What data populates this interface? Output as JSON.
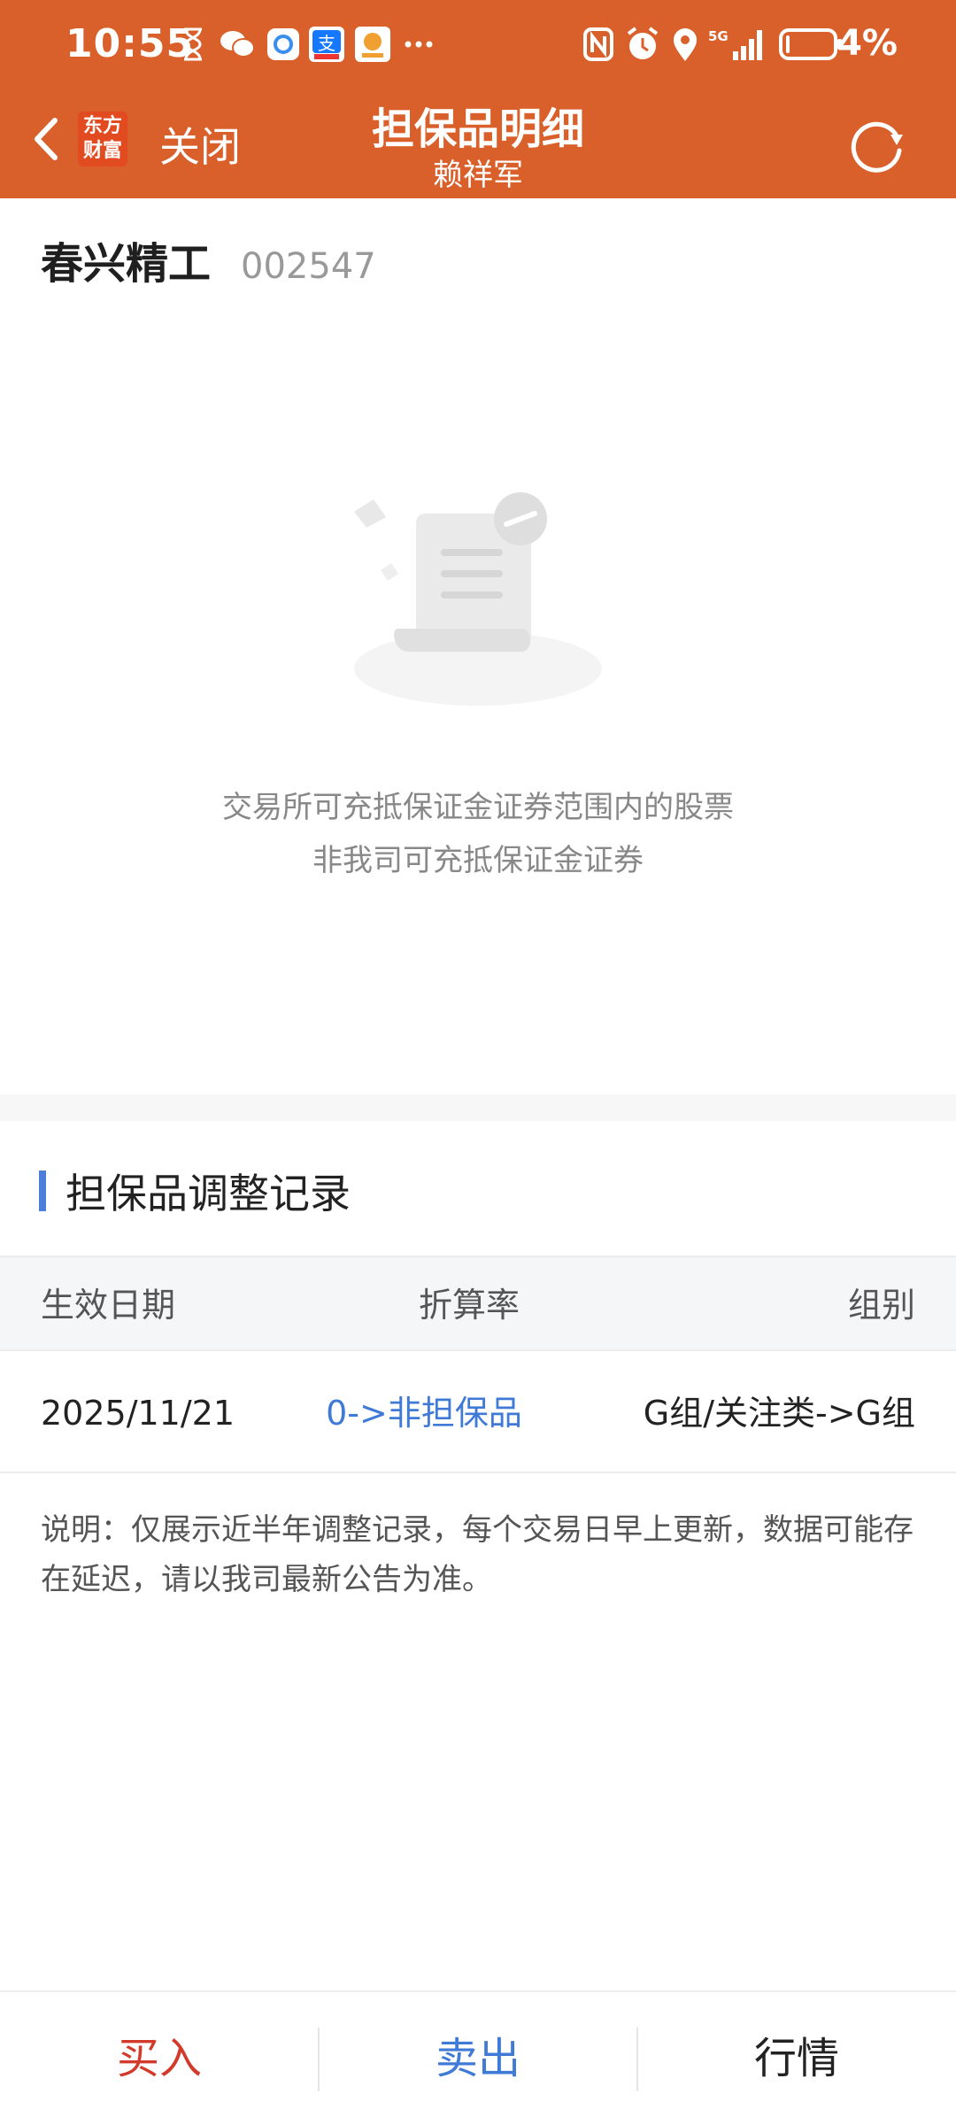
{
  "status_bar": {
    "time": "10:55",
    "network": "5G",
    "battery": "4%"
  },
  "header": {
    "logo_text": "东方财富",
    "close_label": "关闭",
    "title": "担保品明细",
    "subtitle": "赖祥军"
  },
  "stock": {
    "name": "春兴精工",
    "code": "002547"
  },
  "empty_state": {
    "line1": "交易所可充抵保证金证券范围内的股票",
    "line2": "非我司可充抵保证金证券"
  },
  "records": {
    "section_title": "担保品调整记录",
    "columns": [
      "生效日期",
      "折算率",
      "组别"
    ],
    "rows": [
      {
        "date": "2025/11/21",
        "rate": "0->非担保品",
        "group": "G组/关注类->G组"
      }
    ],
    "note": "说明：仅展示近半年调整记录，每个交易日早上更新，数据可能存在延迟，请以我司最新公告为准。"
  },
  "bottom_bar": {
    "buy": "买入",
    "sell": "卖出",
    "quote": "行情"
  },
  "colors": {
    "header_bg": "#d9602a",
    "accent_blue": "#3f7ad6",
    "buy_red": "#d23b2c"
  }
}
